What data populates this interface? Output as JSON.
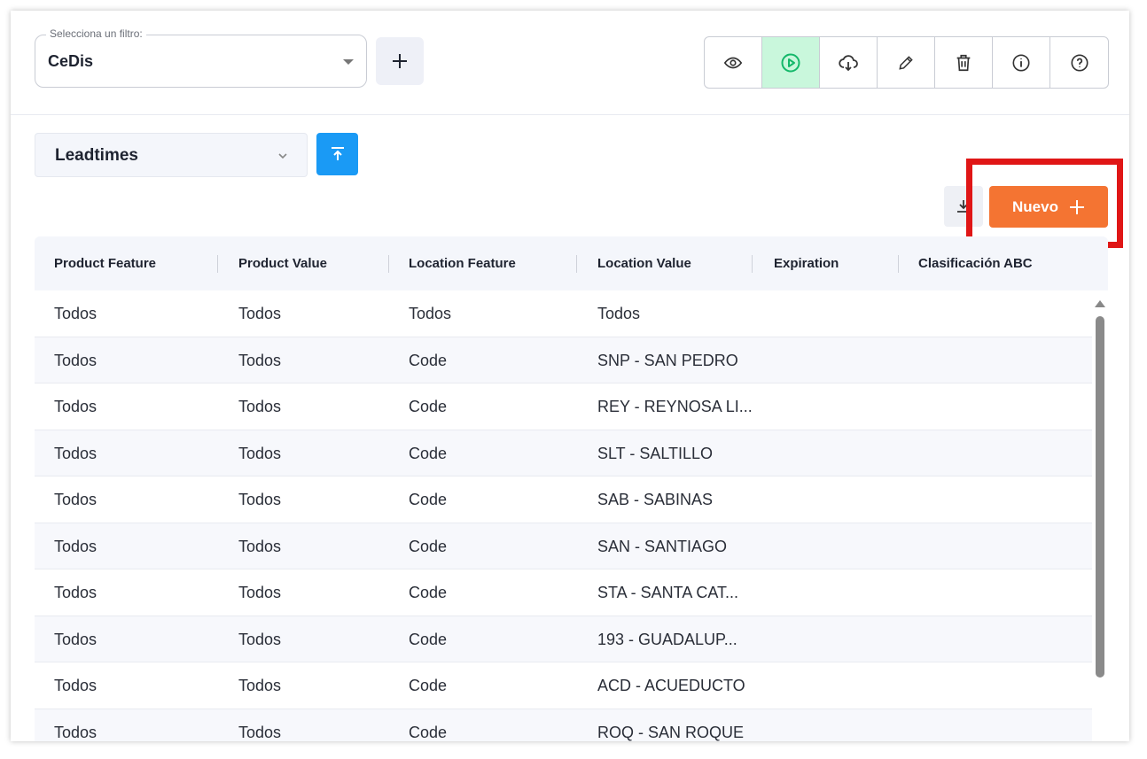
{
  "filter": {
    "label": "Selecciona un filtro:",
    "value": "CeDis"
  },
  "toolbar": {
    "icons": [
      "eye-icon",
      "play-circle-icon",
      "cloud-download-icon",
      "pencil-icon",
      "trash-icon",
      "info-icon",
      "help-icon"
    ],
    "active_index": 1,
    "active_color": "#c9f7dc"
  },
  "table_select": {
    "value": "Leadtimes"
  },
  "actions": {
    "nuevo_label": "Nuevo"
  },
  "colors": {
    "primary_blue": "#1a9af5",
    "accent_orange": "#f47432",
    "highlight_red": "#e01616"
  },
  "table": {
    "columns": [
      "Product Feature",
      "Product Value",
      "Location Feature",
      "Location Value",
      "Expiration",
      "Clasificación ABC"
    ],
    "rows": [
      [
        "Todos",
        "Todos",
        "Todos",
        "Todos"
      ],
      [
        "Todos",
        "Todos",
        "Code",
        "SNP - SAN PEDRO"
      ],
      [
        "Todos",
        "Todos",
        "Code",
        "REY - REYNOSA LI..."
      ],
      [
        "Todos",
        "Todos",
        "Code",
        "SLT - SALTILLO"
      ],
      [
        "Todos",
        "Todos",
        "Code",
        "SAB - SABINAS"
      ],
      [
        "Todos",
        "Todos",
        "Code",
        "SAN - SANTIAGO"
      ],
      [
        "Todos",
        "Todos",
        "Code",
        "STA - SANTA CAT..."
      ],
      [
        "Todos",
        "Todos",
        "Code",
        "193 - GUADALUP..."
      ],
      [
        "Todos",
        "Todos",
        "Code",
        "ACD - ACUEDUCTO"
      ],
      [
        "Todos",
        "Todos",
        "Code",
        "ROQ - SAN ROQUE"
      ]
    ]
  }
}
